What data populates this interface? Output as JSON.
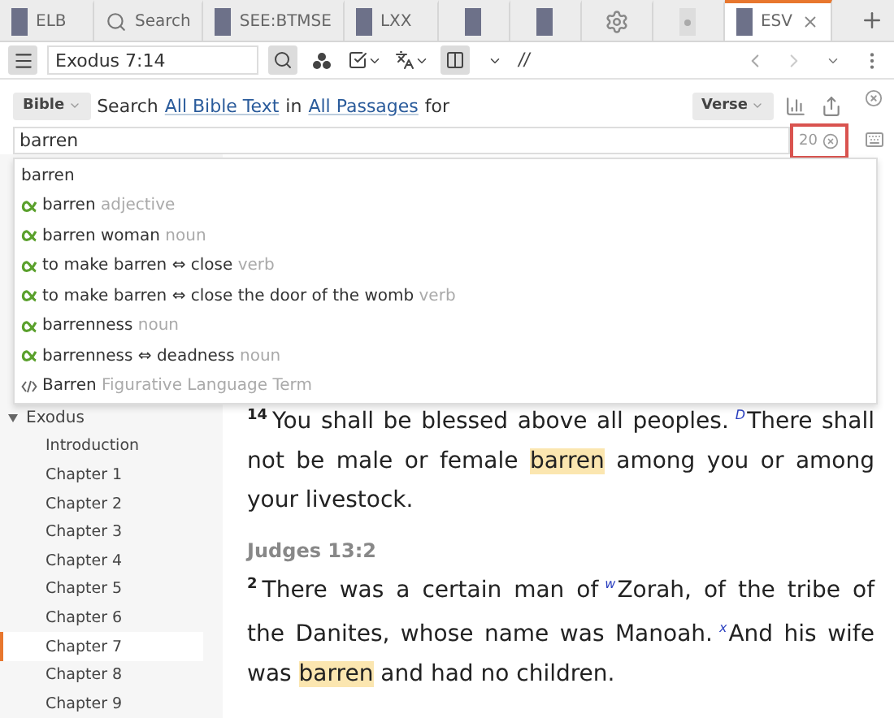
{
  "tabs": [
    {
      "label": "ELB",
      "kind": "book",
      "selected": false
    },
    {
      "label": "Search",
      "kind": "search",
      "selected": false
    },
    {
      "label": "SEE:BTMSE",
      "kind": "book",
      "selected": false
    },
    {
      "label": "LXX",
      "kind": "book",
      "selected": false
    },
    {
      "kind": "book",
      "selected": false
    },
    {
      "kind": "book",
      "selected": false
    },
    {
      "kind": "gear",
      "selected": false
    },
    {
      "kind": "doc",
      "selected": false
    },
    {
      "label": "ESV",
      "kind": "book",
      "selected": true,
      "closable": true
    }
  ],
  "toolbar": {
    "reference": "Exodus 7:14",
    "parallel_symbol": "//"
  },
  "search": {
    "scope": "Bible",
    "prefix": "Search",
    "target": "All Bible Text",
    "joiner": "in",
    "range": "All Passages",
    "suffix": "for",
    "unit": "Verse",
    "query": "barren",
    "count": "20"
  },
  "suggestions": [
    {
      "kind": "plain",
      "term": "barren"
    },
    {
      "kind": "lemma",
      "term": "barren",
      "pos": "adjective"
    },
    {
      "kind": "lemma",
      "term": "barren woman",
      "pos": "noun"
    },
    {
      "kind": "lemma",
      "term": "to make barren ⇔ close",
      "pos": "verb"
    },
    {
      "kind": "lemma",
      "term": "to make barren ⇔ close the door of the womb",
      "pos": "verb"
    },
    {
      "kind": "lemma",
      "term": "barrenness",
      "pos": "noun"
    },
    {
      "kind": "lemma",
      "term": "barrenness ⇔ deadness",
      "pos": "noun"
    },
    {
      "kind": "figure",
      "term": "Barren",
      "pos": "Figurative Language Term"
    }
  ],
  "sidebar": {
    "book": "Exodus",
    "expanded": true,
    "children": [
      {
        "label": "Introduction",
        "selected": false
      },
      {
        "label": "Chapter 1",
        "selected": false
      },
      {
        "label": "Chapter 2",
        "selected": false
      },
      {
        "label": "Chapter 3",
        "selected": false
      },
      {
        "label": "Chapter 4",
        "selected": false
      },
      {
        "label": "Chapter 5",
        "selected": false
      },
      {
        "label": "Chapter 6",
        "selected": false
      },
      {
        "label": "Chapter 7",
        "selected": true
      },
      {
        "label": "Chapter 8",
        "selected": false
      },
      {
        "label": "Chapter 9",
        "selected": false
      }
    ]
  },
  "results": [
    {
      "verse": "14",
      "segments": [
        {
          "kind": "text",
          "text": "You shall be blessed above all peoples."
        },
        {
          "kind": "note",
          "text": "D"
        },
        {
          "kind": "text",
          "text": "There shall not be male or female"
        },
        {
          "kind": "hit",
          "text": "barren"
        },
        {
          "kind": "text",
          "text": "among you or among your livestock."
        }
      ]
    },
    {
      "reference": "Judges 13:2",
      "verse": "2",
      "segments": [
        {
          "kind": "text",
          "text": "There was a certain man of"
        },
        {
          "kind": "note",
          "text": "w"
        },
        {
          "kind": "text",
          "text": "Zorah, of the tribe of the Danites, whose name was Manoah."
        },
        {
          "kind": "note",
          "text": "x"
        },
        {
          "kind": "text",
          "text": "And his wife was"
        },
        {
          "kind": "hit",
          "text": "barren"
        },
        {
          "kind": "text",
          "text": "and had no children."
        }
      ]
    }
  ]
}
